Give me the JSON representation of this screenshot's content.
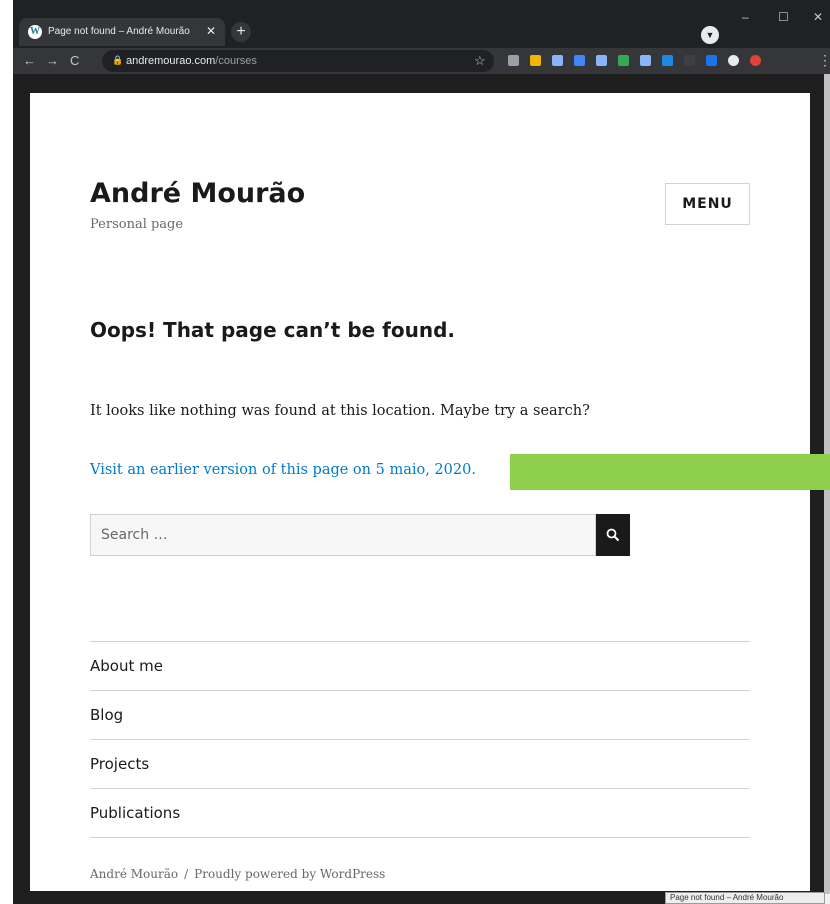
{
  "browser": {
    "tab_title": "Page not found – André Mourão",
    "tab_close": "✕",
    "new_tab": "+",
    "url_host": "andremourao.com",
    "url_path": "/courses",
    "window_controls": {
      "minimize": "–",
      "maximize": "☐",
      "close": "✕"
    },
    "extension_colors": [
      "#9aa0a6",
      "#f4b400",
      "#8ab4f8",
      "#4285f4",
      "#8ab4f8",
      "#34a853",
      "#8ab4f8",
      "#1e88e5",
      "#3c4043",
      "#1a73e8",
      "#e8eaed",
      "#db4437"
    ]
  },
  "site": {
    "title": "André Mourão",
    "tagline": "Personal page",
    "menu_label": "MENU"
  },
  "error": {
    "headline": "Oops! That page can’t be found.",
    "message": "It looks like nothing was found at this location. Maybe try a search?",
    "archive_link": "Visit an earlier version of this page on 5 maio, 2020."
  },
  "search": {
    "placeholder": "Search …"
  },
  "footer_nav": [
    {
      "label": "About me"
    },
    {
      "label": "Blog"
    },
    {
      "label": "Projects"
    },
    {
      "label": "Publications"
    }
  ],
  "footer": {
    "author": "André Mourão",
    "separator": "/",
    "powered": "Proudly powered by WordPress"
  },
  "status_tooltip": "Page not found – André Mourão",
  "colors": {
    "link": "#007acc",
    "text": "#1a1a1a",
    "green_highlight": "#8ecf4c"
  }
}
